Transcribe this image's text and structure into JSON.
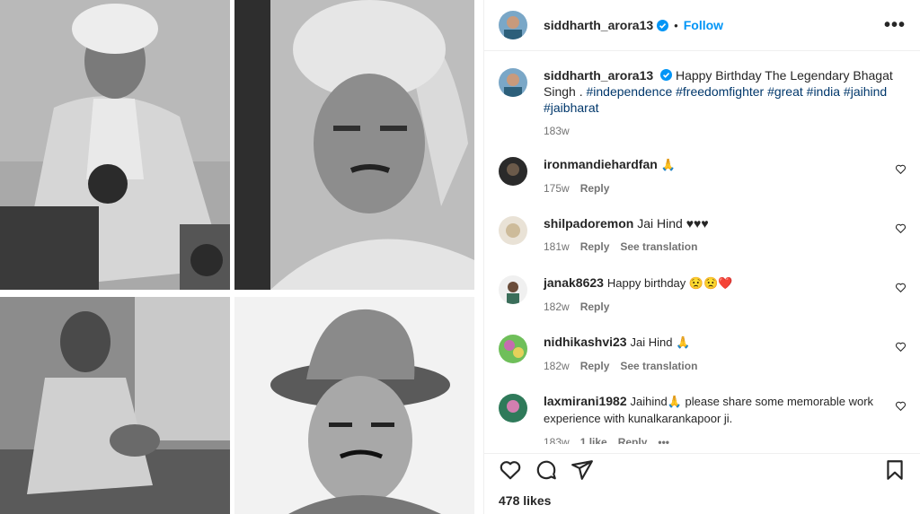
{
  "post": {
    "author": "siddharth_arora13",
    "follow_label": "Follow",
    "separator": "•",
    "more_label": "•••",
    "caption_text": "Happy Birthday The Legendary Bhagat Singh .",
    "caption_tags": "#independence #freedomfighter #great #india #jaihind #jaibharat",
    "caption_time": "183w",
    "likes": "478 likes"
  },
  "comments": [
    {
      "user": "ironmandiehardfan",
      "text": "🙏",
      "time": "175w",
      "reply": "Reply",
      "translate": "",
      "likes": ""
    },
    {
      "user": "shilpadoremon",
      "text": "Jai Hind ♥♥♥",
      "time": "181w",
      "reply": "Reply",
      "translate": "See translation",
      "likes": ""
    },
    {
      "user": "janak8623",
      "text": "Happy birthday 😟😟❤️",
      "time": "182w",
      "reply": "Reply",
      "translate": "",
      "likes": ""
    },
    {
      "user": "nidhikashvi23",
      "text": "Jai Hind 🙏",
      "time": "182w",
      "reply": "Reply",
      "translate": "See translation",
      "likes": ""
    },
    {
      "user": "laxmirani1982",
      "text": "Jaihind🙏 please share some memorable work experience with kunalkarankapoor ji.",
      "time": "183w",
      "reply": "Reply",
      "translate": "",
      "likes": "1 like",
      "more": "•••"
    }
  ],
  "icons": {
    "verified": "verified-badge-icon",
    "like": "heart-icon",
    "comment": "comment-bubble-icon",
    "share": "paper-plane-icon",
    "save": "bookmark-icon",
    "comment_like": "small-heart-icon"
  },
  "colors": {
    "link": "#0095f6",
    "hashtag": "#00376b",
    "muted": "#737373"
  }
}
